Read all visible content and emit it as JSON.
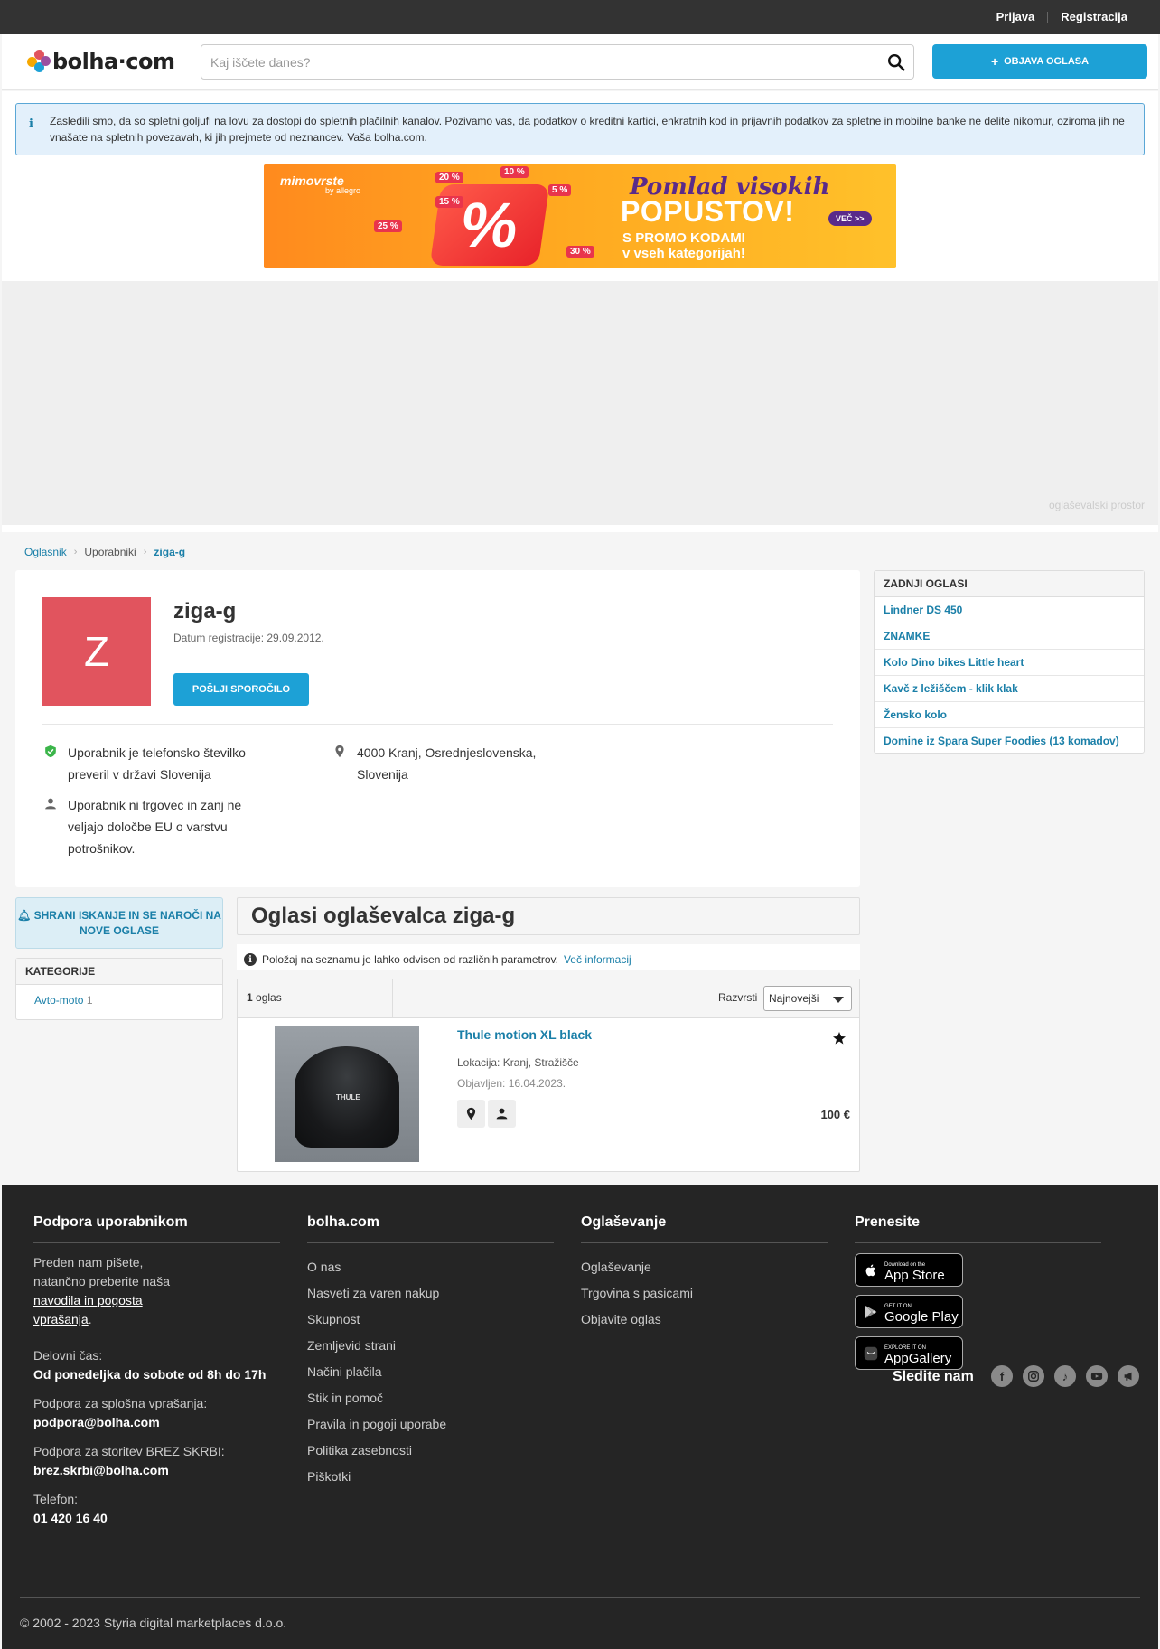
{
  "topbar": {
    "login": "Prijava",
    "register": "Registracija"
  },
  "header": {
    "logo_text": "bolha·com",
    "search_placeholder": "Kaj iščete danes?",
    "post_button": "OBJAVA OGLASA"
  },
  "notice": {
    "text": "Zasledili smo, da so spletni goljufi na lovu za dostopi do spletnih plačilnih kanalov. Pozivamo vas, da podatkov o kreditni kartici, enkratnih kod in prijavnih podatkov za spletne in mobilne banke ne delite nikomur, oziroma jih ne vnašate na spletnih povezavah, ki jih prejmete od neznancev. Vaša bolha.com."
  },
  "banner": {
    "brand": "mimovrste",
    "brand_sub": "by allegro",
    "headline1": "Pomlad visokih",
    "headline2": "POPUSTOV!",
    "headline3a": "S PROMO KODAMI",
    "headline3b": "v vseh kategorijah!",
    "cta": "VEČ >>",
    "chips": [
      "20 %",
      "10 %",
      "5 %",
      "15 %",
      "25 %",
      "30 %"
    ]
  },
  "adspace": {
    "label": "oglaševalski prostor"
  },
  "breadcrumb": {
    "items": [
      "Oglasnik",
      "Uporabniki",
      "ziga-g"
    ]
  },
  "profile": {
    "initial": "Z",
    "username": "ziga-g",
    "registered": "Datum registracije: 29.09.2012.",
    "message_button": "POŠLJI SPOROČILO",
    "verified_text": "Uporabnik je telefonsko številko preveril v državi Slovenija",
    "location_text": "4000 Kranj, Osrednjeslovenska, Slovenija",
    "trader_text": "Uporabnik ni trgovec in zanj ne veljajo določbe EU o varstvu potrošnikov."
  },
  "recent_ads": {
    "title": "ZADNJI OGLASI",
    "items": [
      "Lindner DS 450",
      "ZNAMKE",
      "Kolo Dino bikes Little heart",
      "Kavč z ležiščem - klik klak",
      "Žensko kolo",
      "Domine iz Spara Super Foodies (13 komadov)"
    ]
  },
  "sidebar": {
    "save_search": "SHRANI ISKANJE IN SE NAROČI NA NOVE OGLASE",
    "categories_title": "KATEGORIJE",
    "category": {
      "name": "Avto-moto",
      "count": "1"
    }
  },
  "listing": {
    "title": "Oglasi oglaševalca ziga-g",
    "position_note": "Položaj na seznamu je lahko odvisen od različnih parametrov.",
    "more_info": "Več informacij",
    "count_num": "1",
    "count_label": "oglas",
    "sort_label": "Razvrsti",
    "sort_value": "Najnovejši",
    "ad": {
      "title": "Thule motion XL black",
      "location": "Lokacija: Kranj, Stražišče",
      "published": "Objavljen: 16.04.2023.",
      "price": "100 €",
      "image_label": "THULE"
    }
  },
  "footer": {
    "support": {
      "title": "Podpora uporabnikom",
      "intro1": "Preden nam pišete,",
      "intro2": "natančno preberite naša",
      "link1": "navodila in pogosta",
      "link2": "vprašanja",
      "hours_label": "Delovni čas:",
      "hours": "Od ponedeljka do sobote od 8h do 17h",
      "general_label": "Podpora za splošna vprašanja:",
      "general_email": "podpora@bolha.com",
      "brez_label": "Podpora za storitev BREZ SKRBI:",
      "brez_email": "brez.skrbi@bolha.com",
      "phone_label": "Telefon:",
      "phone": "01 420 16 40"
    },
    "bolha": {
      "title": "bolha.com",
      "links": [
        "O nas",
        "Nasveti za varen nakup",
        "Skupnost",
        "Zemljevid strani",
        "Načini plačila",
        "Stik in pomoč",
        "Pravila in pogoji uporabe",
        "Politika zasebnosti",
        "Piškotki"
      ]
    },
    "advertising": {
      "title": "Oglaševanje",
      "links": [
        "Oglaševanje",
        "Trgovina s pasicami",
        "Objavite oglas"
      ]
    },
    "download": {
      "title": "Prenesite",
      "appstore_small": "Download on the",
      "appstore": "App Store",
      "googleplay_small": "GET IT ON",
      "googleplay": "Google Play",
      "appgallery_small": "EXPLORE IT ON",
      "appgallery": "AppGallery"
    },
    "follow": "Sledite nam",
    "copyright": "© 2002 - 2023 Styria digital marketplaces d.o.o."
  }
}
